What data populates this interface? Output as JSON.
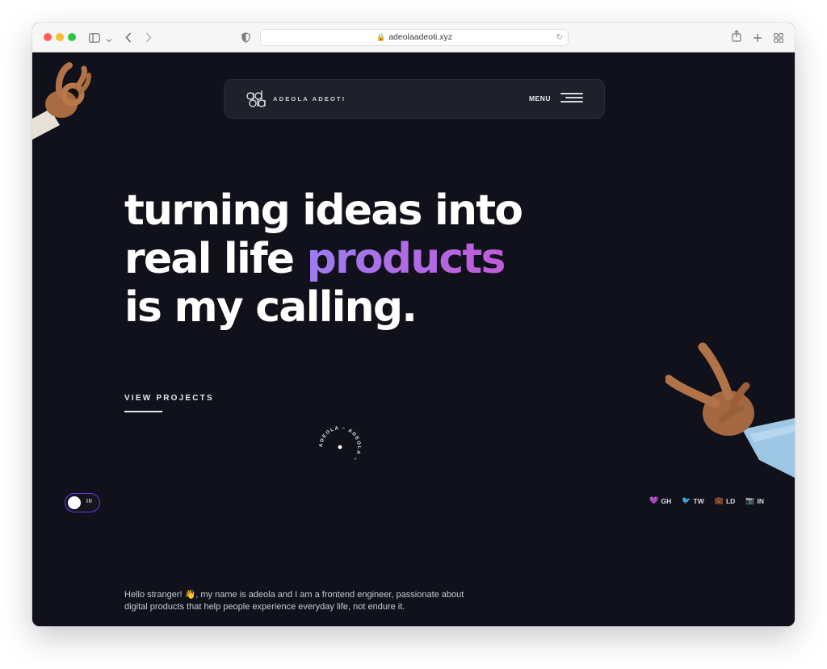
{
  "browser": {
    "url": "adeolaadeoti.xyz",
    "icons": [
      "sidebar-icon",
      "chevron-down-icon",
      "back-icon",
      "forward-icon",
      "shield-icon",
      "lock-icon",
      "reload-icon",
      "share-icon",
      "new-tab-icon",
      "tab-overview-icon"
    ]
  },
  "navbar": {
    "brand": "ADEOLA ADEOTI",
    "menu_label": "MENU"
  },
  "hero": {
    "line1": "turning ideas into",
    "line2_start": "real life ",
    "line2_accent": "products",
    "line3": "is my calling.",
    "cta": "VIEW PROJECTS",
    "badge_text": "ADEOLA ~ ADEOLA ~ "
  },
  "toggle": {
    "label": "III"
  },
  "socials": [
    {
      "label": "GH",
      "icon": "github-icon"
    },
    {
      "label": "TW",
      "icon": "twitter-icon"
    },
    {
      "label": "LD",
      "icon": "linkedin-icon"
    },
    {
      "label": "IN",
      "icon": "instagram-icon"
    }
  ],
  "intro": {
    "text": "Hello stranger! 👋, my name is adeola and I am a frontend engineer, passionate about digital products that help people experience everyday life, not endure it."
  },
  "colors": {
    "background": "#10111a",
    "nav_bg": "#1f2029",
    "accent_start": "#9c7cf0",
    "accent_end": "#c15bd8",
    "toggle_border": "#6a38e6"
  }
}
